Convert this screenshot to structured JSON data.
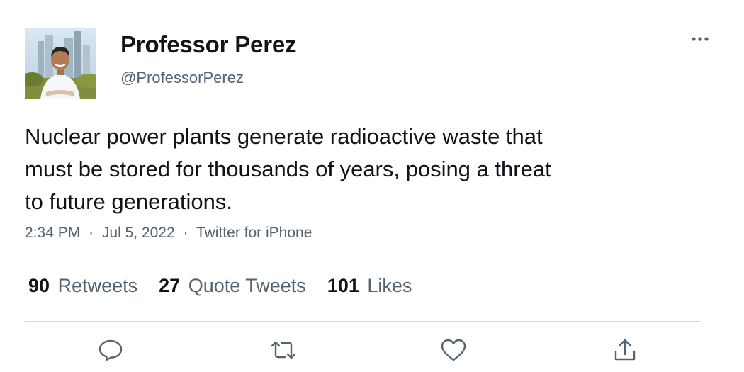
{
  "author": {
    "display_name": "Professor Perez",
    "handle": "@ProfessorPerez",
    "avatar_icon": "profile-photo"
  },
  "tweet": {
    "text_lines": [
      "Nuclear power plants generate radioactive waste that",
      "must be stored for thousands of years, posing a threat",
      "to future generations."
    ],
    "time": "2:34 PM",
    "date": "Jul 5, 2022",
    "source": "Twitter for iPhone",
    "separator": "·"
  },
  "stats": {
    "retweets": {
      "count": "90",
      "label": "Retweets"
    },
    "quotes": {
      "count": "27",
      "label": "Quote Tweets"
    },
    "likes": {
      "count": "101",
      "label": "Likes"
    }
  },
  "actions": [
    "reply-icon",
    "retweet-icon",
    "like-icon",
    "share-icon"
  ],
  "colors": {
    "text": "#0f1419",
    "secondary": "#536471",
    "divider": "#cfd9de"
  }
}
